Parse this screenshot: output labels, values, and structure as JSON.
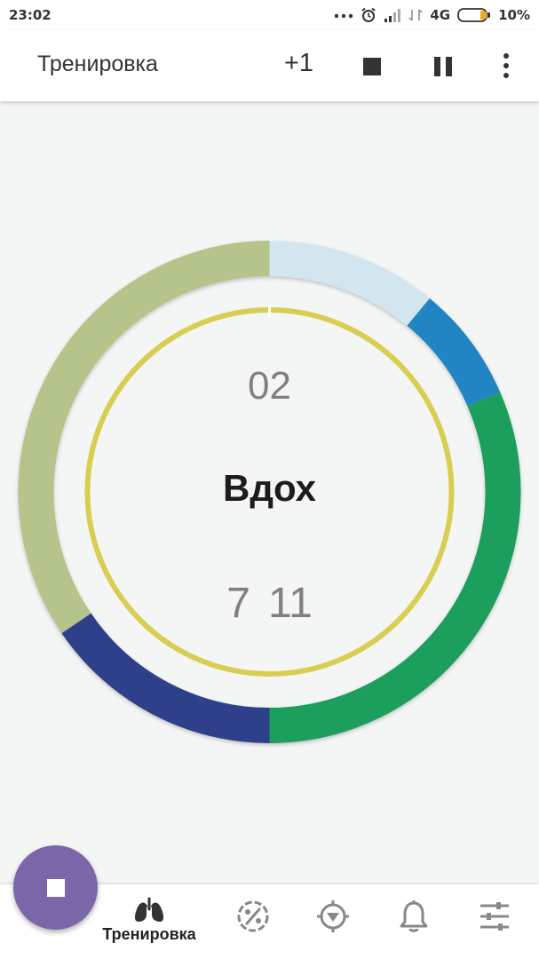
{
  "status_bar": {
    "time": "23:02",
    "network": "4G",
    "battery": "10%",
    "icons": [
      "more-dots-icon",
      "alarm-icon",
      "signal-icon",
      "signal-off-icon",
      "battery-icon"
    ]
  },
  "app_bar": {
    "title": "Тренировка",
    "plus_one_label": "+1",
    "stop_icon": "stop-icon",
    "pause_icon": "pause-icon",
    "more_icon": "more-vert-icon"
  },
  "ring": {
    "counter_top": "02",
    "phase_label": "Вдох",
    "counter_bottom_left": "7",
    "counter_bottom_right": "11",
    "segments": [
      {
        "color": "#d3e6ef",
        "fraction": 0.11
      },
      {
        "color": "#2285c3",
        "fraction": 0.075
      },
      {
        "color": "#1a9e5c",
        "fraction": 0.315
      },
      {
        "color": "#2f418a",
        "fraction": 0.155
      },
      {
        "color": "#b5c48a",
        "fraction": 0.345
      }
    ],
    "inner_ring_color": "#d9cd52"
  },
  "bottom_nav": {
    "items": [
      {
        "label": "Тренировка",
        "icon": "lungs-icon",
        "active": true
      },
      {
        "label": "",
        "icon": "percent-dial-icon",
        "active": false
      },
      {
        "label": "",
        "icon": "compass-down-icon",
        "active": false
      },
      {
        "label": "",
        "icon": "bell-icon",
        "active": false
      },
      {
        "label": "",
        "icon": "sliders-icon",
        "active": false
      }
    ]
  },
  "fab": {
    "icon": "stop-icon",
    "color": "#7a67a9"
  }
}
